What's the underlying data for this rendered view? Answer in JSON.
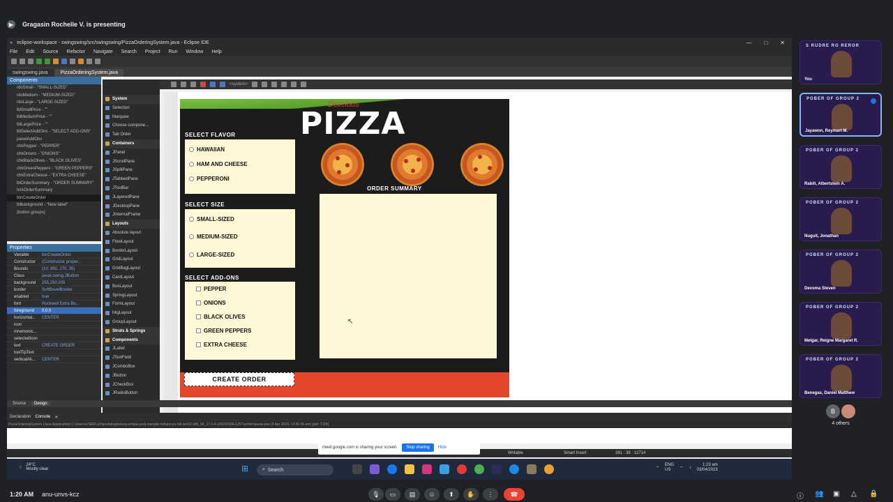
{
  "meet": {
    "presenter_text": "Gragasin Rochelle V. is presenting",
    "clock": "1:20 AM",
    "meeting_code": "anu-unvs-kcz",
    "others_label": "4 others",
    "others_initial": "B",
    "share_notice": "meet.google.com is sharing your screen.",
    "stop_sharing": "Stop sharing",
    "hide": "Hide"
  },
  "participants": [
    {
      "banner": "S RUDRE RO REROR",
      "name": "You"
    },
    {
      "banner": "POBER OF GROUP 2",
      "name": "Jayawon, Reymart M."
    },
    {
      "banner": "POBER OF GROUP 2",
      "name": "Rabili, Albertstein A."
    },
    {
      "banner": "POBER OF GROUP 2",
      "name": "Nuguit, Jonathan"
    },
    {
      "banner": "POBER OF GROUP 2",
      "name": "Devoma Steven"
    },
    {
      "banner": "POBER OF GROUP 2",
      "name": "Melgar, Reigne Margaret R."
    },
    {
      "banner": "POBER OF GROUP 2",
      "name": "Benegas, Daniel Matthew"
    }
  ],
  "eclipse": {
    "title": "eclipse-workspace - swingswing/src/swingswing/PizzaOrderingSystem.java - Eclipse IDE",
    "menu": [
      "File",
      "Edit",
      "Source",
      "Refactor",
      "Navigate",
      "Search",
      "Project",
      "Run",
      "Window",
      "Help"
    ],
    "editor_tabs": [
      "swingswing.java",
      "PizzaOrderingSystem.java"
    ],
    "structure_head": "Components",
    "tree": [
      "rdoSmall - \"SMALL-SIZED\"",
      "rdoMedium - \"MEDIUM-SIZED\"",
      "rdoLarge - \"LARGE-SIZED\"",
      "lblSmallPrice - \"\"",
      "lblMediumPrice - \"\"",
      "lblLargePrice - \"\"",
      "lblSelectAddOns - \"SELECT ADD-ONS\"",
      "panelAddOns",
      "chkPepper - \"PEPPER\"",
      "chkOnions - \"ONIONS\"",
      "chkBlackOlives - \"BLACK OLIVES\"",
      "chkGreenPeppers - \"GREEN PEPPERS\"",
      "chkExtraCheese - \"EXTRA CHEESE\"",
      "lblOrderSummary - \"ORDER SUMMARY\"",
      "txtAOrderSummary",
      "btnCreateOrder",
      "lblbackground - \"New label\"",
      "(button groups)"
    ],
    "properties_head": "Properties",
    "properties": [
      {
        "k": "Variable",
        "v": "btnCreateOrder"
      },
      {
        "k": "Constructor",
        "v": "(Constructor proper..."
      },
      {
        "k": "Bounds",
        "v": "(10, 892, 270, 35)"
      },
      {
        "k": "Class",
        "v": "javax.swing.JButton"
      },
      {
        "k": "background",
        "v": "255,250,205"
      },
      {
        "k": "border",
        "v": "SoftBevelBorder"
      },
      {
        "k": "enabled",
        "v": "true"
      },
      {
        "k": "font",
        "v": "Rockwell Extra Bo..."
      },
      {
        "k": "foreground",
        "v": "0,0,0"
      },
      {
        "k": "horizontal...",
        "v": "CENTER"
      },
      {
        "k": "icon",
        "v": ""
      },
      {
        "k": "mnemonic...",
        "v": ""
      },
      {
        "k": "selectedIcon",
        "v": ""
      },
      {
        "k": "text",
        "v": "CREATE ORDER"
      },
      {
        "k": "toolTipText",
        "v": ""
      },
      {
        "k": "verticalAli...",
        "v": "CENTER"
      }
    ],
    "palette": [
      {
        "t": "System",
        "cat": true
      },
      {
        "t": "Selection"
      },
      {
        "t": "Marquee"
      },
      {
        "t": "Choose compone..."
      },
      {
        "t": "Tab Order"
      },
      {
        "t": "Containers",
        "cat": true
      },
      {
        "t": "JPanel"
      },
      {
        "t": "JScrollPane"
      },
      {
        "t": "JSplitPane"
      },
      {
        "t": "JTabbedPane"
      },
      {
        "t": "JToolBar"
      },
      {
        "t": "JLayeredPane"
      },
      {
        "t": "JDesktopPane"
      },
      {
        "t": "JInternalFrame"
      },
      {
        "t": "Layouts",
        "cat": true
      },
      {
        "t": "Absolute layout"
      },
      {
        "t": "FlowLayout"
      },
      {
        "t": "BorderLayout"
      },
      {
        "t": "GridLayout"
      },
      {
        "t": "GridBagLayout"
      },
      {
        "t": "CardLayout"
      },
      {
        "t": "BoxLayout"
      },
      {
        "t": "SpringLayout"
      },
      {
        "t": "FormLayout"
      },
      {
        "t": "MigLayout"
      },
      {
        "t": "GroupLayout"
      },
      {
        "t": "Struts & Springs",
        "cat": true
      },
      {
        "t": "Components",
        "cat": true
      },
      {
        "t": "JLabel"
      },
      {
        "t": "JTextField"
      },
      {
        "t": "JComboBox"
      },
      {
        "t": "JButton"
      },
      {
        "t": "JCheckBox"
      },
      {
        "t": "JRadioButton"
      }
    ],
    "design_tools_label": "<system>",
    "source_tab": "Source",
    "design_tab": "Design",
    "console_tabs": [
      "Declaration",
      "Console"
    ],
    "console_line": "PizzaOrderingSystem [Java Application] C:\\Users\\USER\\.p2\\pool\\plugins\\org.eclipse.justj.openjdk.hotspot.jre.full.win32.x86_64_17.0.4.v20221004-1257\\jre\\bin\\javaw.exe (3 Apr 2023, 12:56:36 am) [pid: 7328]",
    "status": {
      "writable": "Writable",
      "insert": "Smart Insert",
      "pos": "281 : 38 : 12714"
    }
  },
  "pizza_app": {
    "title": "PIZZA",
    "logo_script": "Delicious",
    "select_flavor": "SELECT FLAVOR",
    "flavors": [
      "HAWAIIAN",
      "HAM AND CHEESE",
      "PEPPERONI"
    ],
    "select_size": "SELECT SIZE",
    "sizes": [
      "SMALL-SIZED",
      "MEDIUM-SIZED",
      "LARGE-SIZED"
    ],
    "select_addons": "SELECT ADD-ONS",
    "addons": [
      "PEPPER",
      "ONIONS",
      "BLACK OLIVES",
      "GREEN PEPPERS",
      "EXTRA CHEESE"
    ],
    "order_summary": "ORDER SUMMARY",
    "create_order": "CREATE ORDER"
  },
  "taskbar": {
    "weather_temp": "24°C",
    "weather_desc": "Mostly clear",
    "search": "Search",
    "lang": "ENG",
    "region": "US",
    "time": "1:23 am",
    "date": "03/04/2023"
  }
}
